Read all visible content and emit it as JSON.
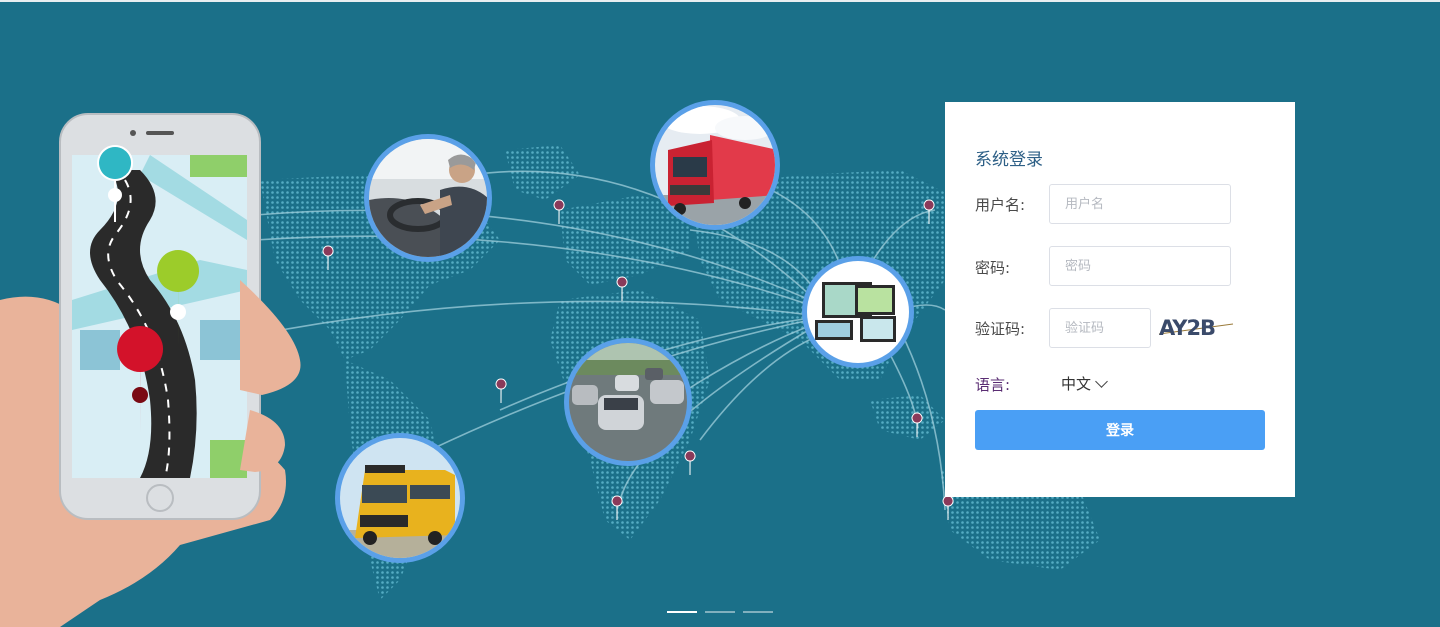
{
  "login": {
    "title": "系统登录",
    "username_label": "用户名:",
    "username_placeholder": "用户名",
    "username_value": "",
    "password_label": "密码:",
    "password_placeholder": "密码",
    "password_value": "",
    "captcha_label": "验证码:",
    "captcha_placeholder": "验证码",
    "captcha_value": "",
    "captcha_text": "AY2B",
    "language_label": "语言:",
    "language_value": "中文",
    "submit_label": "登录"
  },
  "carousel": {
    "slides": 3,
    "active_index": 0
  },
  "colors": {
    "background": "#1b7089",
    "primary_button": "#4a9ff5",
    "title": "#2d5f86"
  },
  "icons": [
    "phone-map-illustration",
    "world-map",
    "location-pin-icon",
    "driver-photo",
    "truck-photo",
    "cars-photo",
    "school-bus-photo",
    "devices-photo",
    "captcha-image"
  ]
}
